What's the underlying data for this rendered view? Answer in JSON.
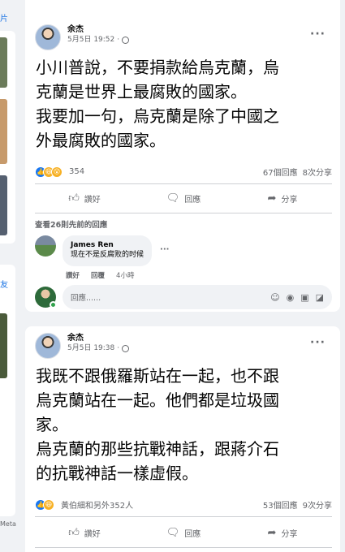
{
  "side": {
    "text_a": "片",
    "text_b": "友",
    "meta": "Meta"
  },
  "posts": [
    {
      "author": "余杰",
      "date": "5月5日 19:52",
      "privacy_icon": "globe-icon",
      "more_label": "···",
      "lines": [
        "小川普說，不要捐款給烏克蘭，烏",
        "克蘭是世界上最腐敗的國家。",
        "我要加一句，烏克蘭是除了中國之",
        "外最腐敗的國家。"
      ],
      "reaction_count": "354",
      "comments_count": "67個回應",
      "shares_count": "8次分享",
      "actions": {
        "like": "讚好",
        "comment": "回應",
        "share": "分享"
      },
      "previous_comments": "查看26則先前的回應",
      "comment": {
        "name": "James Ren",
        "text": "现在不是反腐败的时候",
        "like": "讚好",
        "reply": "回覆",
        "time": "4小時"
      },
      "write_placeholder": "回應......"
    },
    {
      "author": "余杰",
      "date": "5月5日 19:38",
      "privacy_icon": "globe-icon",
      "more_label": "···",
      "lines": [
        "我既不跟俄羅斯站在一起，也不跟",
        "烏克蘭站在一起。他們都是垃圾國",
        "家。",
        "烏克蘭的那些抗戰神話，跟蔣介石",
        "的抗戰神話一樣虛假。"
      ],
      "reaction_label": "黃伯細和另外352人",
      "comments_count": "53個回應",
      "shares_count": "9次分享",
      "actions": {
        "like": "讚好",
        "comment": "回應",
        "share": "分享"
      }
    }
  ],
  "colors": {
    "background": "#f0f2f5",
    "card": "#ffffff",
    "like_blue": "#1877f2",
    "haha_yellow": "#f7b125",
    "secondary_text": "#65676b"
  }
}
